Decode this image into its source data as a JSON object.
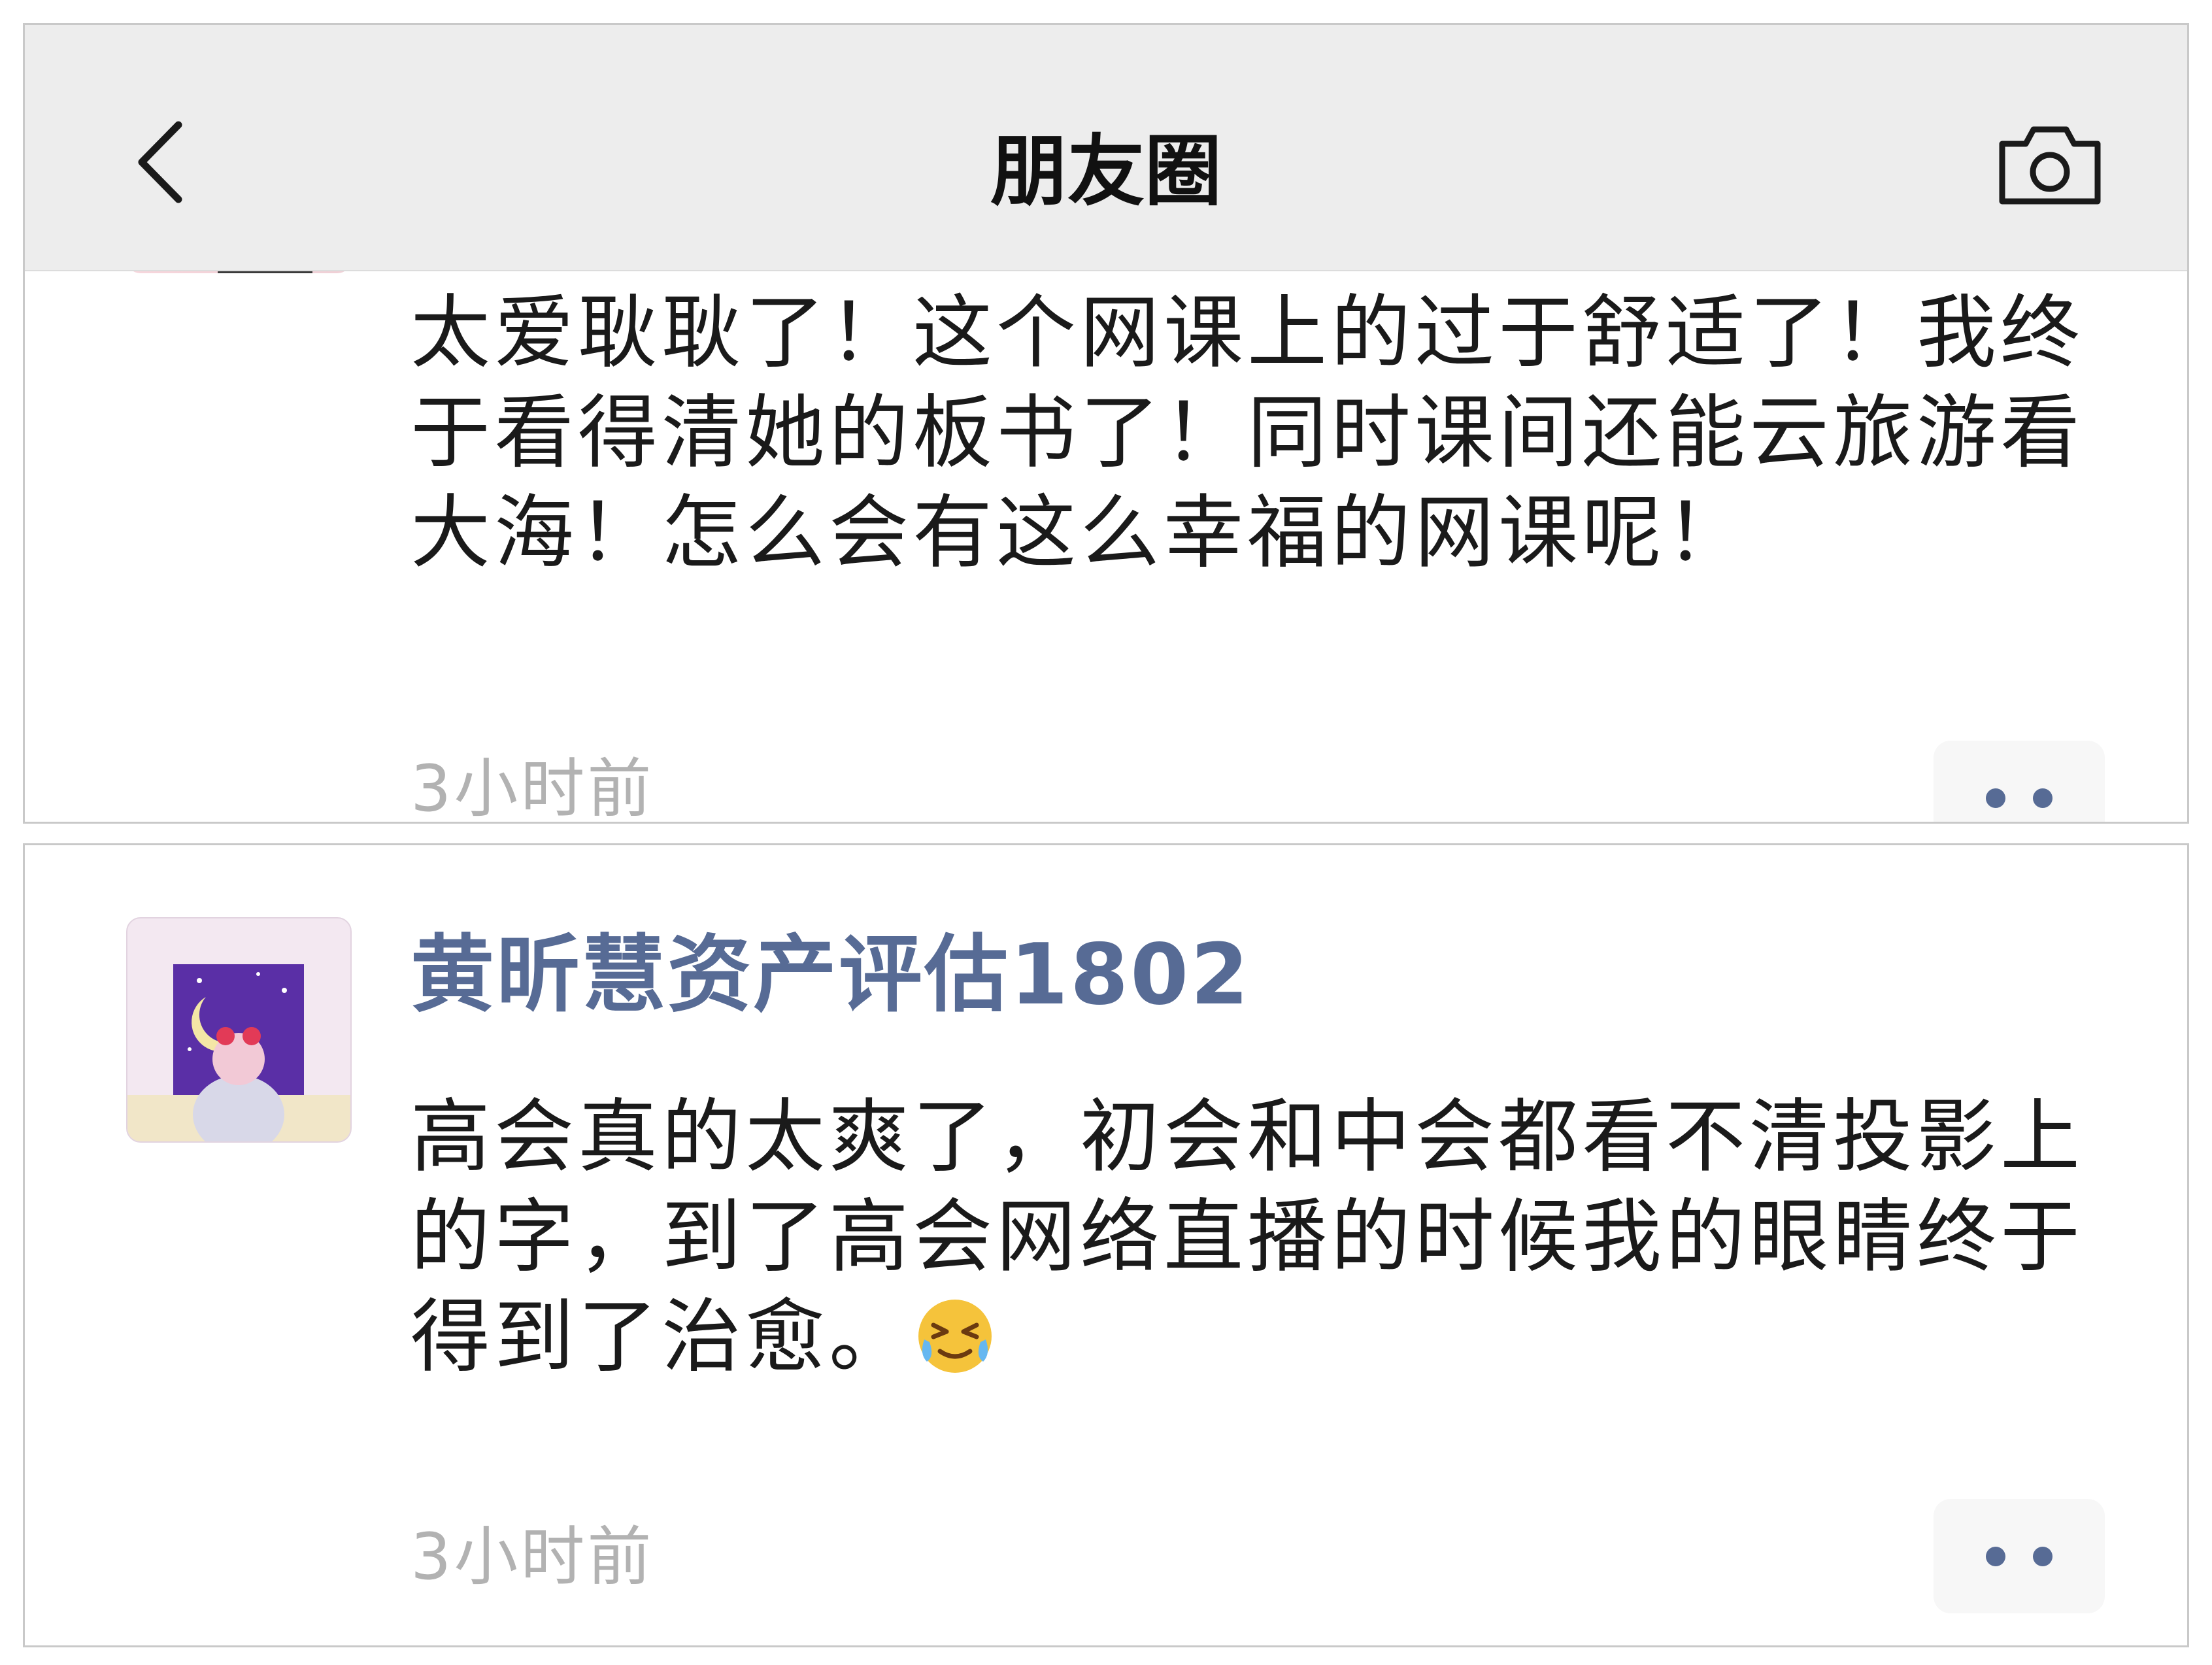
{
  "app": {
    "title": "朋友圈",
    "accent_color": "#576b95",
    "back_icon": "chevron-left-icon",
    "camera_icon": "camera-icon"
  },
  "posts": [
    {
      "author": "",
      "text": "太爱耿耿了！这个网课上的过于舒适了！我终于看得清她的板书了！同时课间还能云旅游看大海！怎么会有这么幸福的网课呢！",
      "time": "3小时前",
      "more_icon": "more-options-icon"
    },
    {
      "author": "黄昕慧资产评估1802",
      "text": "高会真的太爽了，初会和中会都看不清投影上的字，到了高会网络直播的时候我的眼睛终于得到了治愈。",
      "emoji": "laughing-crying-emoji",
      "time": "3小时前",
      "more_icon": "more-options-icon"
    }
  ]
}
